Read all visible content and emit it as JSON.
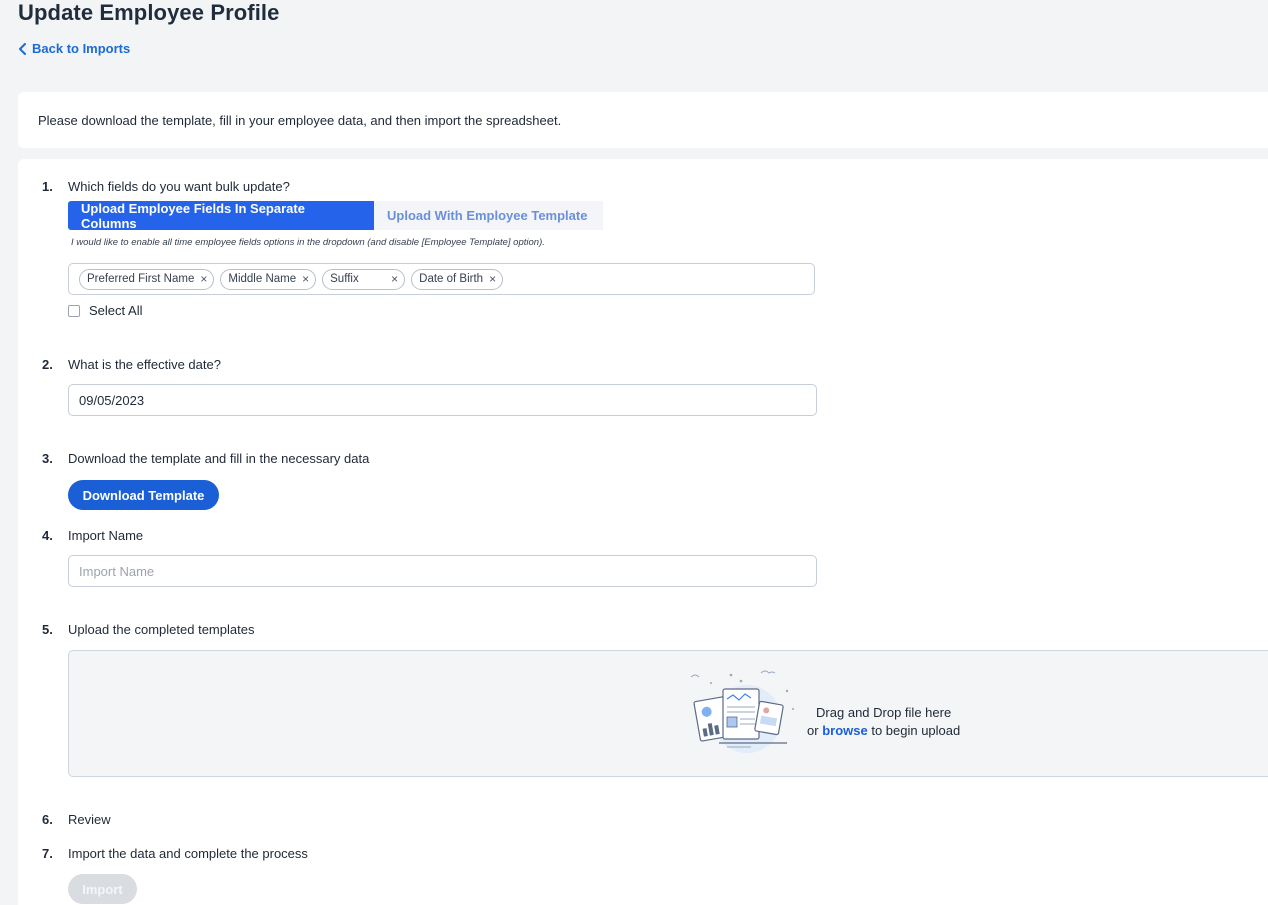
{
  "header": {
    "title": "Update Employee Profile",
    "back_label": "Back to Imports"
  },
  "intro": {
    "text": "Please download the template, fill in your employee data, and then import the spreadsheet."
  },
  "steps": {
    "s1": {
      "num": "1.",
      "label": "Which fields do you want bulk update?",
      "tab_active": "Upload Employee Fields In Separate Columns",
      "tab_inactive": "Upload With Employee Template",
      "hint": "I would like to enable all time employee fields options in the dropdown (and disable [Employee Template] option).",
      "tags": [
        "Preferred First Name",
        "Middle Name",
        "Suffix",
        "Date of Birth"
      ],
      "tag_remove": "×",
      "select_all": "Select All"
    },
    "s2": {
      "num": "2.",
      "label": "What is the effective date?",
      "value": "09/05/2023"
    },
    "s3": {
      "num": "3.",
      "label": "Download the template and fill in the necessary data",
      "button": "Download Template"
    },
    "s4": {
      "num": "4.",
      "label": "Import Name",
      "placeholder": "Import Name"
    },
    "s5": {
      "num": "5.",
      "label": "Upload the completed templates",
      "drop_line1": "Drag and Drop file here",
      "drop_or": "or",
      "drop_browse": "browse",
      "drop_rest": "to begin upload"
    },
    "s6": {
      "num": "6.",
      "label": "Review"
    },
    "s7": {
      "num": "7.",
      "label": "Import the data and complete the process",
      "button": "Import"
    }
  },
  "colors": {
    "accent": "#1a5fd6",
    "active_tab": "#2563eb",
    "disabled": "#d9dce1"
  }
}
